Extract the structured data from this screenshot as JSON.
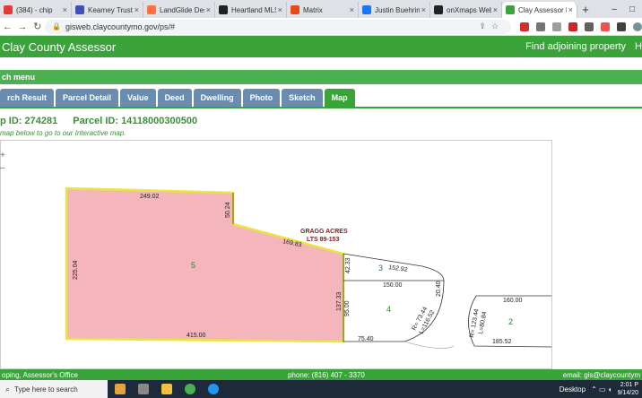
{
  "browser": {
    "tabs": [
      {
        "label": "(384) - chip",
        "color": "#e53935"
      },
      {
        "label": "Kearney Trust Co",
        "color": "#3f51b5"
      },
      {
        "label": "LandGlide Deskt",
        "color": "#ff7043"
      },
      {
        "label": "Heartland MLS",
        "color": "#212121"
      },
      {
        "label": "Matrix",
        "color": "#e64a19"
      },
      {
        "label": "Justin Buehring",
        "color": "#1877f2"
      },
      {
        "label": "onXmaps Web A",
        "color": "#222222"
      },
      {
        "label": "Clay Assessor Pa",
        "color": "#3aa33a",
        "active": true
      }
    ],
    "url": "gisweb.claycountymo.gov/ps/#",
    "newtab": "+",
    "close": "×",
    "minimize": "–",
    "maximize": "□"
  },
  "site": {
    "title": "Clay County Assessor",
    "find_adjoining": "Find adjoining property",
    "right_initial": "H",
    "search_menu": "ch menu"
  },
  "tabs": [
    {
      "label": "rch Result"
    },
    {
      "label": "Parcel Detail"
    },
    {
      "label": "Value"
    },
    {
      "label": "Deed"
    },
    {
      "label": "Dwelling"
    },
    {
      "label": "Photo"
    },
    {
      "label": "Sketch"
    },
    {
      "label": "Map",
      "active": true
    }
  ],
  "parcel": {
    "map_id": "p ID: 274281",
    "parcel_id": "Parcel ID: 14118000300500",
    "instruction": "map below to go to our Interactive map."
  },
  "map": {
    "subdivision_line1": "GRAGG ACRES",
    "subdivision_line2": "LTS 89-153",
    "lots": [
      {
        "id": "lot-5",
        "label": "5"
      },
      {
        "id": "lot-3",
        "label": "3"
      },
      {
        "id": "lot-4",
        "label": "4"
      },
      {
        "id": "lot-2",
        "label": "2"
      }
    ],
    "dims": {
      "d249": "249.02",
      "d50": "50.24",
      "d169": "169.83",
      "d225": "225.04",
      "d415": "415.00",
      "d137": "137.33",
      "d4233": "42.33",
      "d152": "152.92",
      "d150a": "150.00",
      "d2040": "20.40",
      "d95": "95.00",
      "d7544": "R= 73.44",
      "d11652": "L=116.52",
      "d7540": "75.40",
      "d160": "160.00",
      "d12344": "R= 123.44",
      "d8084": "L=80.84",
      "d18552": "185.52"
    },
    "zoom_in": "+",
    "zoom_out": "–",
    "colors": {
      "highlight_fill": "#f4b6bb",
      "highlight_border": "#e8e83a",
      "lot_label": "#2e7d32",
      "subdivision": "#8b1a1a"
    }
  },
  "footer": {
    "left": "oping, Assessor's Office",
    "phone": "phone: (816) 407 - 3370",
    "email": "email: gis@claycountym"
  },
  "taskbar": {
    "search_placeholder": "Type here to search",
    "desktop": "Desktop",
    "time": "2:01 P",
    "date": "9/14/20"
  }
}
